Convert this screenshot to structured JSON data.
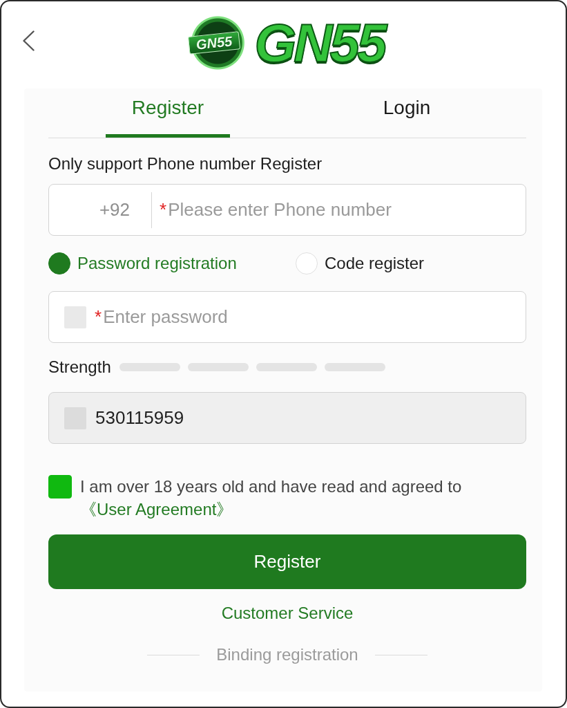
{
  "logo": {
    "emblem_text": "GN55",
    "wordmark": "GN55"
  },
  "tabs": [
    {
      "label": "Register",
      "selected": true
    },
    {
      "label": "Login",
      "selected": false
    }
  ],
  "notice": "Only support Phone number Register",
  "phone_field": {
    "country_code": "+92",
    "required_mark": "*",
    "placeholder": "Please enter Phone number"
  },
  "methods": [
    {
      "label": "Password registration",
      "selected": true
    },
    {
      "label": "Code register",
      "selected": false
    }
  ],
  "password_field": {
    "required_mark": "*",
    "placeholder": "Enter password"
  },
  "strength": {
    "label": "Strength",
    "segments": [
      {
        "on": false
      },
      {
        "on": false
      },
      {
        "on": false
      },
      {
        "on": false
      }
    ]
  },
  "prefilled_field": {
    "value": "530115959",
    "readonly": true
  },
  "agreement": {
    "checked": true,
    "text": "I am over 18 years old and have read and agreed to ",
    "link": "《User Agreement》"
  },
  "register_button": "Register",
  "customer_service": "Customer Service",
  "binding": "Binding registration"
}
